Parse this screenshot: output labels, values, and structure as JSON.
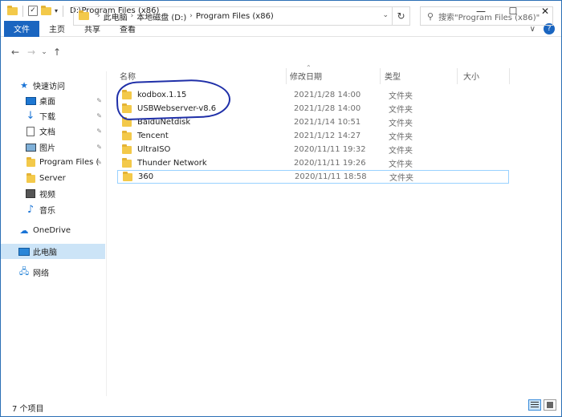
{
  "window": {
    "title": "D:\\Program Files (x86)",
    "controls": {
      "minimize": "—",
      "maximize": "☐",
      "close": "✕"
    }
  },
  "quick_access_toolbar": {
    "dropdown": "▾"
  },
  "ribbon": {
    "tabs": [
      "文件",
      "主页",
      "共享",
      "查看"
    ],
    "expand": "∨",
    "help": "?"
  },
  "navigation": {
    "back": "←",
    "forward": "→",
    "recent": "⌄",
    "up": "↑"
  },
  "address": {
    "crumbs": [
      "此电脑",
      "本地磁盘 (D:)",
      "Program Files (x86)"
    ],
    "chevron": "›",
    "dropdown": "⌄",
    "refresh": "↻"
  },
  "search": {
    "icon": "⚲",
    "placeholder": "搜索\"Program Files (x86)\""
  },
  "sidebar": {
    "quick_access": "快速访问",
    "items": [
      {
        "label": "桌面",
        "icon": "desktop-icon",
        "pinned": true
      },
      {
        "label": "下载",
        "icon": "download-icon",
        "pinned": true
      },
      {
        "label": "文档",
        "icon": "document-icon",
        "pinned": true
      },
      {
        "label": "图片",
        "icon": "picture-icon",
        "pinned": true
      },
      {
        "label": "Program Files (",
        "icon": "folder-icon",
        "pinned": true
      },
      {
        "label": "Server",
        "icon": "folder-icon",
        "pinned": false
      },
      {
        "label": "视频",
        "icon": "video-icon",
        "pinned": false
      },
      {
        "label": "音乐",
        "icon": "music-icon",
        "pinned": false
      }
    ],
    "pin_glyph": "📌",
    "onedrive": "OneDrive",
    "this_pc": "此电脑",
    "network": "网络"
  },
  "columns": {
    "name": "名称",
    "date": "修改日期",
    "type": "类型",
    "size": "大小",
    "sort_indicator": "⌃"
  },
  "files": [
    {
      "name": "kodbox.1.15",
      "date": "2021/1/28 14:00",
      "type": "文件夹"
    },
    {
      "name": "USBWebserver-v8.6",
      "date": "2021/1/28 14:00",
      "type": "文件夹"
    },
    {
      "name": "BaiduNetdisk",
      "date": "2021/1/14 10:51",
      "type": "文件夹"
    },
    {
      "name": "Tencent",
      "date": "2021/1/12 14:27",
      "type": "文件夹"
    },
    {
      "name": "UltraISO",
      "date": "2020/11/11 19:32",
      "type": "文件夹"
    },
    {
      "name": "Thunder Network",
      "date": "2020/11/11 19:26",
      "type": "文件夹"
    },
    {
      "name": "360",
      "date": "2020/11/11 18:58",
      "type": "文件夹"
    }
  ],
  "selected_file": "360",
  "status": {
    "count": "7 个项目"
  },
  "colors": {
    "accent": "#1a65c0",
    "selection": "#cce4f7",
    "annotation": "#1f2fa8",
    "folder": "#f3c94a"
  }
}
